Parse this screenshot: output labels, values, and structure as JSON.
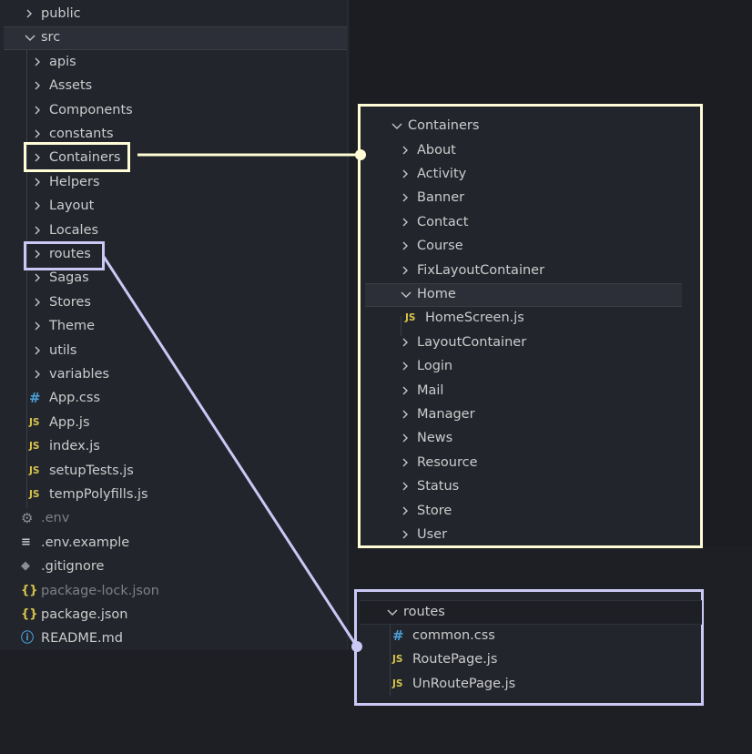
{
  "explorer": {
    "items": [
      {
        "type": "folder",
        "label": "public",
        "expanded": false,
        "depth": 0
      },
      {
        "type": "folder",
        "label": "src",
        "expanded": true,
        "depth": 0
      },
      {
        "type": "folder",
        "label": "apis",
        "expanded": false,
        "depth": 1
      },
      {
        "type": "folder",
        "label": "Assets",
        "expanded": false,
        "depth": 1
      },
      {
        "type": "folder",
        "label": "Components",
        "expanded": false,
        "depth": 1
      },
      {
        "type": "folder",
        "label": "constants",
        "expanded": false,
        "depth": 1
      },
      {
        "type": "folder",
        "label": "Containers",
        "expanded": false,
        "depth": 1
      },
      {
        "type": "folder",
        "label": "Helpers",
        "expanded": false,
        "depth": 1
      },
      {
        "type": "folder",
        "label": "Layout",
        "expanded": false,
        "depth": 1
      },
      {
        "type": "folder",
        "label": "Locales",
        "expanded": false,
        "depth": 1
      },
      {
        "type": "folder",
        "label": "routes",
        "expanded": false,
        "depth": 1
      },
      {
        "type": "folder",
        "label": "Sagas",
        "expanded": false,
        "depth": 1
      },
      {
        "type": "folder",
        "label": "Stores",
        "expanded": false,
        "depth": 1
      },
      {
        "type": "folder",
        "label": "Theme",
        "expanded": false,
        "depth": 1
      },
      {
        "type": "folder",
        "label": "utils",
        "expanded": false,
        "depth": 1
      },
      {
        "type": "folder",
        "label": "variables",
        "expanded": false,
        "depth": 1
      },
      {
        "type": "file",
        "label": "App.css",
        "icon": "css-icon",
        "depth": 1
      },
      {
        "type": "file",
        "label": "App.js",
        "icon": "js-icon",
        "depth": 1
      },
      {
        "type": "file",
        "label": "index.js",
        "icon": "js-icon",
        "depth": 1
      },
      {
        "type": "file",
        "label": "setupTests.js",
        "icon": "js-icon",
        "depth": 1
      },
      {
        "type": "file",
        "label": "tempPolyfills.js",
        "icon": "js-icon",
        "depth": 1
      },
      {
        "type": "file",
        "label": ".env",
        "icon": "gear-icon",
        "depth": 0,
        "dim": true
      },
      {
        "type": "file",
        "label": ".env.example",
        "icon": "lines-icon",
        "depth": 0
      },
      {
        "type": "file",
        "label": ".gitignore",
        "icon": "git-icon",
        "depth": 0
      },
      {
        "type": "file",
        "label": "package-lock.json",
        "icon": "json-icon",
        "depth": 0,
        "dim": true
      },
      {
        "type": "file",
        "label": "package.json",
        "icon": "json-icon",
        "depth": 0
      },
      {
        "type": "file",
        "label": "README.md",
        "icon": "info-icon",
        "depth": 0
      }
    ]
  },
  "containers_zoom": {
    "root": "Containers",
    "items": [
      {
        "type": "folder",
        "label": "About"
      },
      {
        "type": "folder",
        "label": "Activity"
      },
      {
        "type": "folder",
        "label": "Banner"
      },
      {
        "type": "folder",
        "label": "Contact"
      },
      {
        "type": "folder",
        "label": "Course"
      },
      {
        "type": "folder",
        "label": "FixLayoutContainer"
      },
      {
        "type": "folder",
        "label": "Home",
        "expanded": true
      },
      {
        "type": "file",
        "label": "HomeScreen.js",
        "icon": "js-icon",
        "nested": true
      },
      {
        "type": "folder",
        "label": "LayoutContainer"
      },
      {
        "type": "folder",
        "label": "Login"
      },
      {
        "type": "folder",
        "label": "Mail"
      },
      {
        "type": "folder",
        "label": "Manager"
      },
      {
        "type": "folder",
        "label": "News"
      },
      {
        "type": "folder",
        "label": "Resource"
      },
      {
        "type": "folder",
        "label": "Status"
      },
      {
        "type": "folder",
        "label": "Store"
      },
      {
        "type": "folder",
        "label": "User"
      }
    ]
  },
  "routes_zoom": {
    "root": "routes",
    "items": [
      {
        "type": "file",
        "label": "common.css",
        "icon": "css-icon"
      },
      {
        "type": "file",
        "label": "RoutePage.js",
        "icon": "js-icon"
      },
      {
        "type": "file",
        "label": "UnRoutePage.js",
        "icon": "js-icon"
      }
    ]
  },
  "icon_glyphs": {
    "js-icon": "JS",
    "css-icon": "#",
    "json-icon": "{}",
    "info-icon": "ⓘ",
    "gear-icon": "⚙",
    "lines-icon": "≡",
    "git-icon": "◆"
  },
  "colors": {
    "highlight_yellow": "#fffcd6",
    "highlight_purple": "#cbc8f5",
    "panel_bg": "#22252c"
  }
}
